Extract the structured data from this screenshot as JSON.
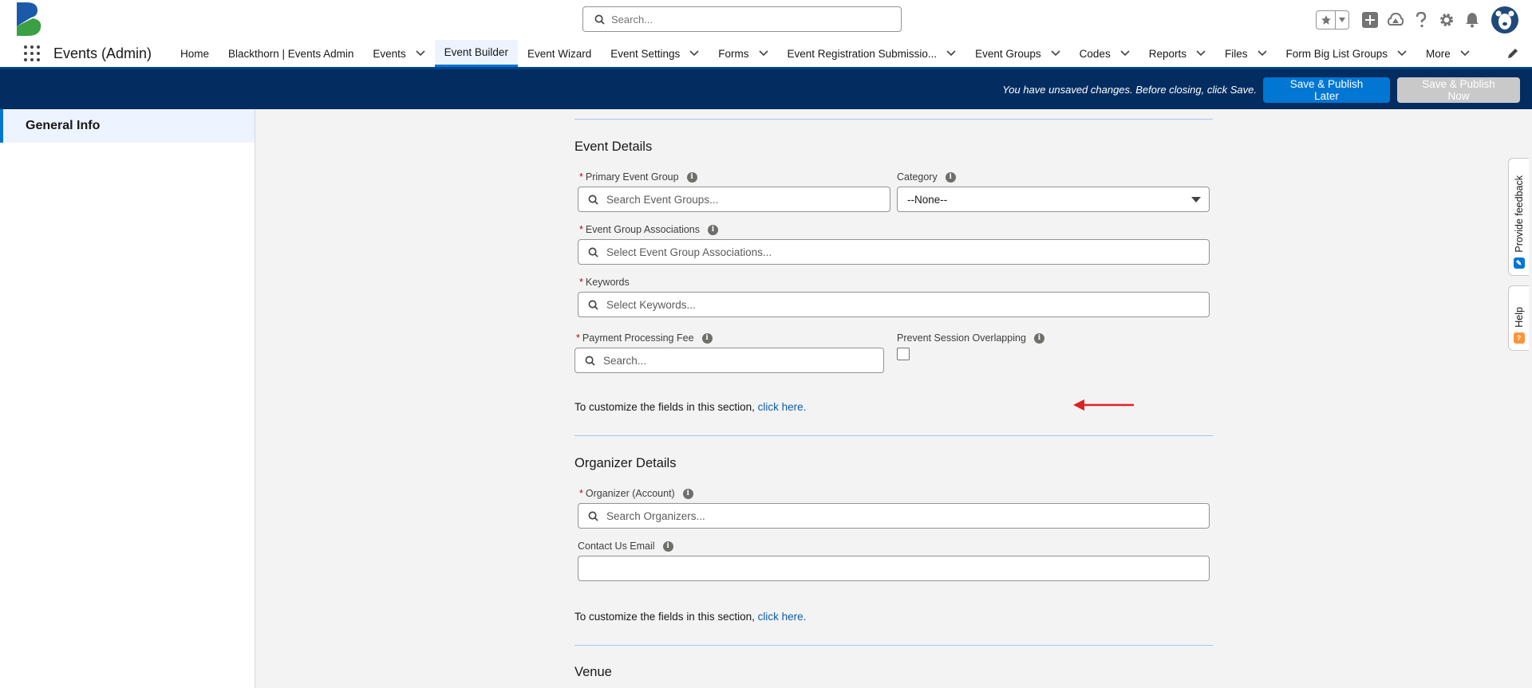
{
  "header": {
    "search_placeholder": "Search..."
  },
  "nav": {
    "app_name": "Events (Admin)",
    "items": [
      {
        "label": "Home",
        "dropdown": false
      },
      {
        "label": "Blackthorn | Events Admin",
        "dropdown": false
      },
      {
        "label": "Events",
        "dropdown": true
      },
      {
        "label": "Event Builder",
        "dropdown": false,
        "active": true
      },
      {
        "label": "Event Wizard",
        "dropdown": false
      },
      {
        "label": "Event Settings",
        "dropdown": true
      },
      {
        "label": "Forms",
        "dropdown": true
      },
      {
        "label": "Event Registration Submissio...",
        "dropdown": true
      },
      {
        "label": "Event Groups",
        "dropdown": true
      },
      {
        "label": "Codes",
        "dropdown": true
      },
      {
        "label": "Reports",
        "dropdown": true
      },
      {
        "label": "Files",
        "dropdown": true
      },
      {
        "label": "Form Big List Groups",
        "dropdown": true
      },
      {
        "label": "More",
        "dropdown": true
      }
    ]
  },
  "save_bar": {
    "message": "You have unsaved changes. Before closing, click Save.",
    "publish_later": "Save & Publish Later",
    "publish_now": "Save & Publish Now"
  },
  "sidebar": {
    "items": [
      {
        "label": "General Info",
        "active": true
      }
    ]
  },
  "event_details": {
    "title": "Event Details",
    "primary_event_group": {
      "label": "Primary Event Group",
      "placeholder": "Search Event Groups..."
    },
    "category": {
      "label": "Category",
      "value": "--None--"
    },
    "event_group_associations": {
      "label": "Event Group Associations",
      "placeholder": "Select Event Group Associations..."
    },
    "keywords": {
      "label": "Keywords",
      "placeholder": "Select Keywords..."
    },
    "payment_processing_fee": {
      "label": "Payment Processing Fee",
      "placeholder": "Search..."
    },
    "prevent_session_overlapping": {
      "label": "Prevent Session Overlapping",
      "checked": false
    },
    "customize_text": "To customize the fields in this section, ",
    "customize_link": "click here."
  },
  "organizer_details": {
    "title": "Organizer Details",
    "organizer": {
      "label": "Organizer (Account)",
      "placeholder": "Search Organizers..."
    },
    "contact_email": {
      "label": "Contact Us Email",
      "value": ""
    },
    "customize_text": "To customize the fields in this section, ",
    "customize_link": "click here."
  },
  "venue": {
    "title": "Venue"
  },
  "utility": {
    "feedback": "Provide feedback",
    "help": "Help"
  },
  "colors": {
    "brand_blue": "#0176d3",
    "save_bar": "#032d60",
    "annotation_arrow": "#e02020"
  }
}
